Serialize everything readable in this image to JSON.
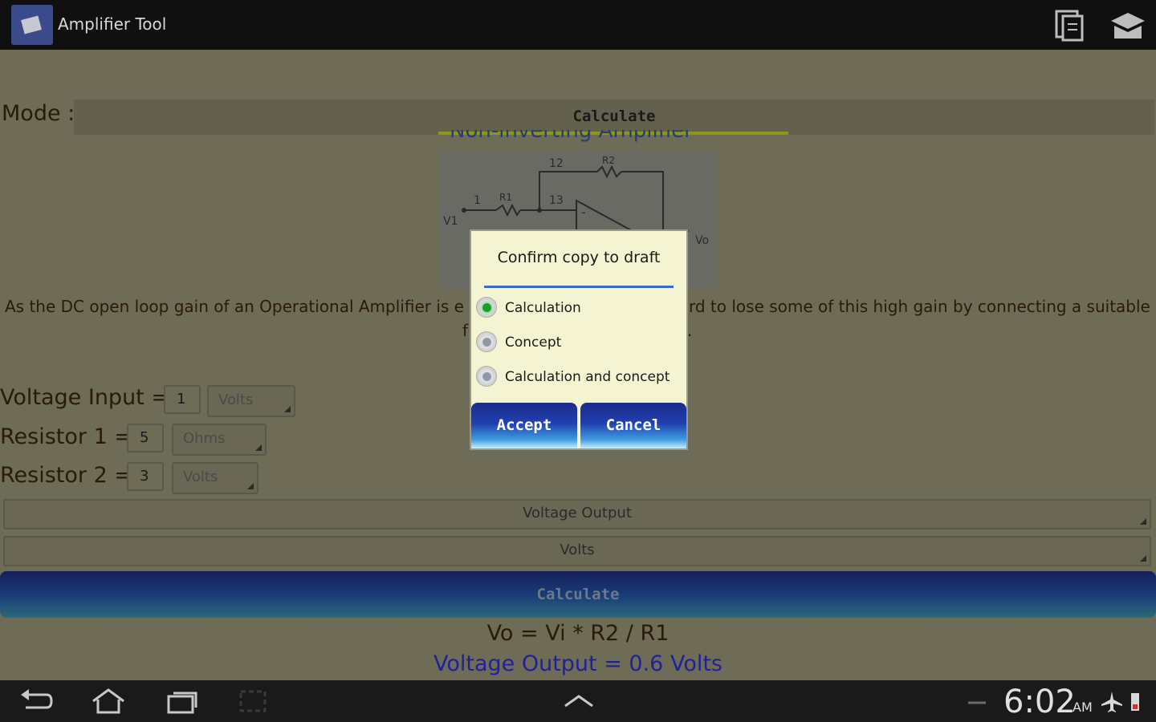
{
  "actionbar": {
    "title": "Amplifier Tool",
    "icons": [
      "copy-icon",
      "graduation-cap-icon"
    ]
  },
  "mode": {
    "label": "Mode :",
    "tab": "Calculate"
  },
  "diagram": {
    "title": "Non-inverting Amplifier",
    "labels": {
      "v1": "V1",
      "vo": "Vo",
      "r1": "R1",
      "r2": "R2",
      "n1": "1",
      "n12": "12",
      "n13": "13"
    }
  },
  "description": {
    "line1_left": "As the DC open loop gain of an Operational Amplifier is e",
    "line1_right": "rd to lose some of this high gain by connecting a suitable",
    "line2_left": "f",
    "line2_right": "."
  },
  "fields": {
    "voltage_input": {
      "label": "Voltage Input =",
      "value": "1",
      "unit": "Volts"
    },
    "resistor1": {
      "label": "Resistor 1 =",
      "value": "5",
      "unit": "Ohms"
    },
    "resistor2": {
      "label": "Resistor 2 =",
      "value": "3",
      "unit": "Volts"
    }
  },
  "output_select": "Voltage Output",
  "output_unit": "Volts",
  "calculate_button": "Calculate",
  "formula": "Vo = Vi * R2 / R1",
  "result": "Voltage Output = 0.6 Volts",
  "dialog": {
    "title": "Confirm copy to draft",
    "options": [
      "Calculation",
      "Concept",
      "Calculation and concept"
    ],
    "selected": "Calculation",
    "accept": "Accept",
    "cancel": "Cancel"
  },
  "statusbar": {
    "time": "6:02",
    "ampm": "AM"
  }
}
